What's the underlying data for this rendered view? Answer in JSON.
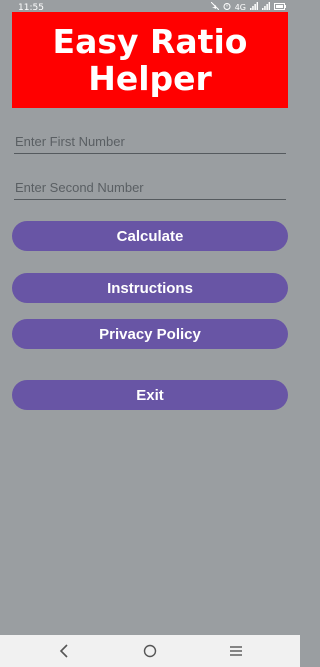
{
  "status_bar": {
    "time": "11:55",
    "icons": [
      "mute-icon",
      "alarm-icon",
      "network-4g-icon",
      "signal-icon",
      "signal-icon-2",
      "battery-icon"
    ],
    "network_label": "4G"
  },
  "header": {
    "title": "Easy Ratio Helper"
  },
  "form": {
    "first_placeholder": "Enter First Number",
    "second_placeholder": "Enter Second Number"
  },
  "buttons": {
    "calculate": "Calculate",
    "instructions": "Instructions",
    "privacy": "Privacy Policy",
    "exit": "Exit"
  },
  "navigation": {
    "icons": [
      "back-icon",
      "home-icon",
      "menu-icon"
    ]
  },
  "colors": {
    "background": "#9a9ea1",
    "banner": "#ff0000",
    "button": "#6855a5",
    "nav_bar": "#f1f1f1"
  }
}
